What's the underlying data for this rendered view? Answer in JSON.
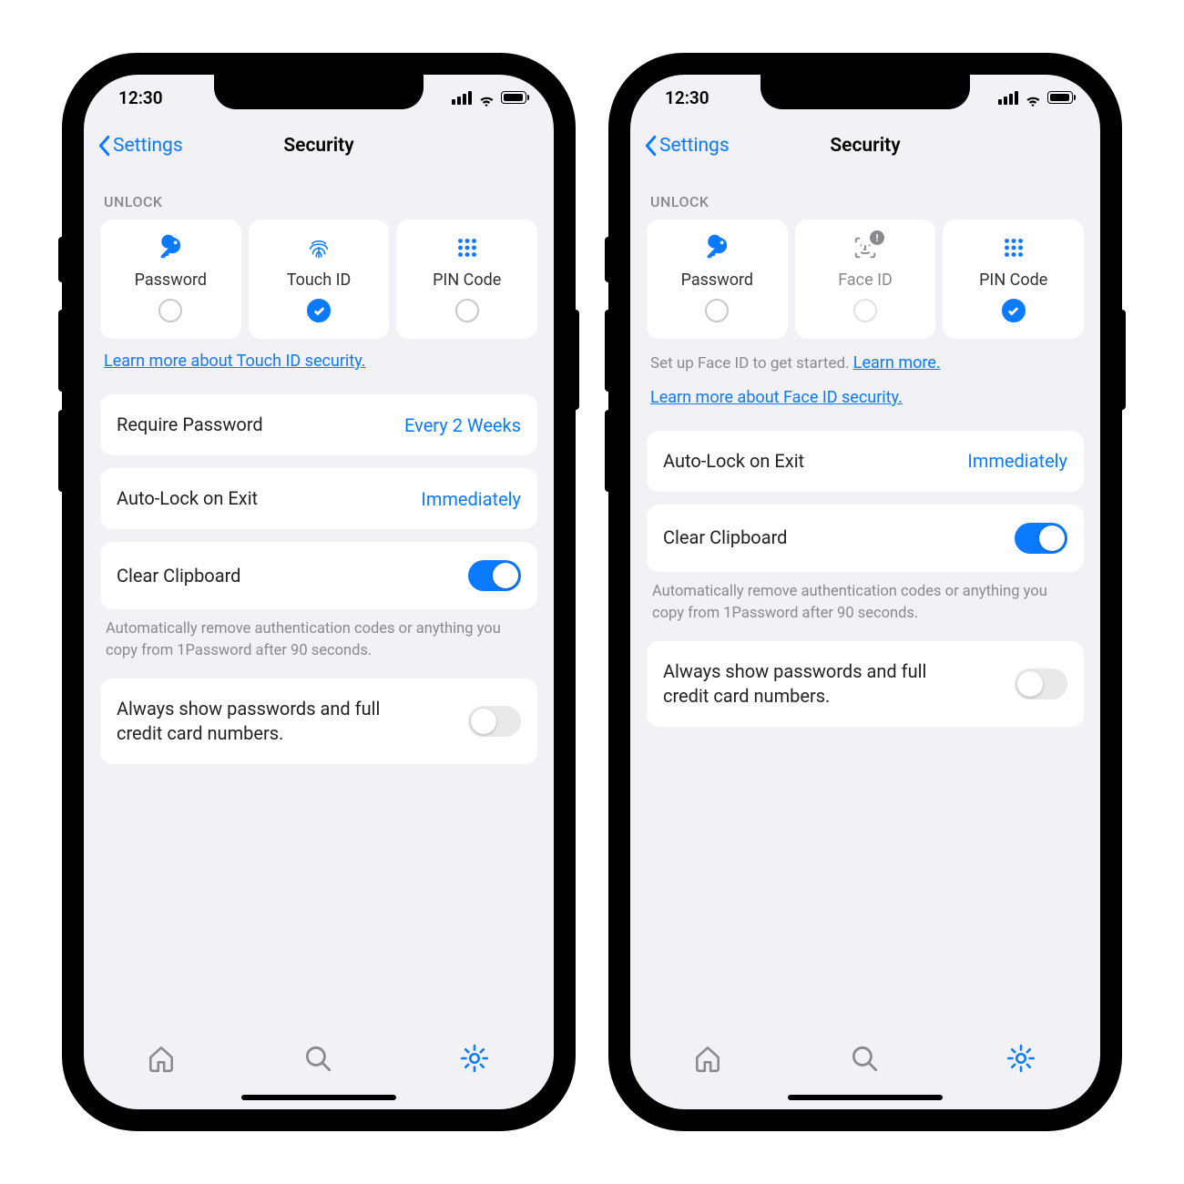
{
  "left": {
    "status_time": "12:30",
    "back_label": "Settings",
    "title": "Security",
    "section_unlock": "UNLOCK",
    "unlock_options": {
      "password": "Password",
      "touchid": "Touch ID",
      "pincode": "PIN Code"
    },
    "selected_unlock": "touchid",
    "learn_link": "Learn more about Touch ID security.",
    "require_password": {
      "label": "Require Password",
      "value": "Every 2 Weeks"
    },
    "autolock": {
      "label": "Auto-Lock on Exit",
      "value": "Immediately"
    },
    "clear_clipboard": {
      "label": "Clear Clipboard",
      "on": true
    },
    "clipboard_helper": "Automatically remove authentication codes or anything you copy from 1Password after 90 seconds.",
    "always_show": {
      "label": "Always show passwords and full credit card numbers.",
      "on": false
    }
  },
  "right": {
    "status_time": "12:30",
    "back_label": "Settings",
    "title": "Security",
    "section_unlock": "UNLOCK",
    "unlock_options": {
      "password": "Password",
      "faceid": "Face ID",
      "pincode": "PIN Code"
    },
    "selected_unlock": "pincode",
    "faceid_hint_prefix": "Set up Face ID to get started. ",
    "faceid_hint_link": "Learn more.",
    "learn_link": "Learn more about Face ID security.",
    "autolock": {
      "label": "Auto-Lock on Exit",
      "value": "Immediately"
    },
    "clear_clipboard": {
      "label": "Clear Clipboard",
      "on": true
    },
    "clipboard_helper": "Automatically remove authentication codes or anything you copy from 1Password after 90 seconds.",
    "always_show": {
      "label": "Always show passwords and full credit card numbers.",
      "on": false
    }
  }
}
